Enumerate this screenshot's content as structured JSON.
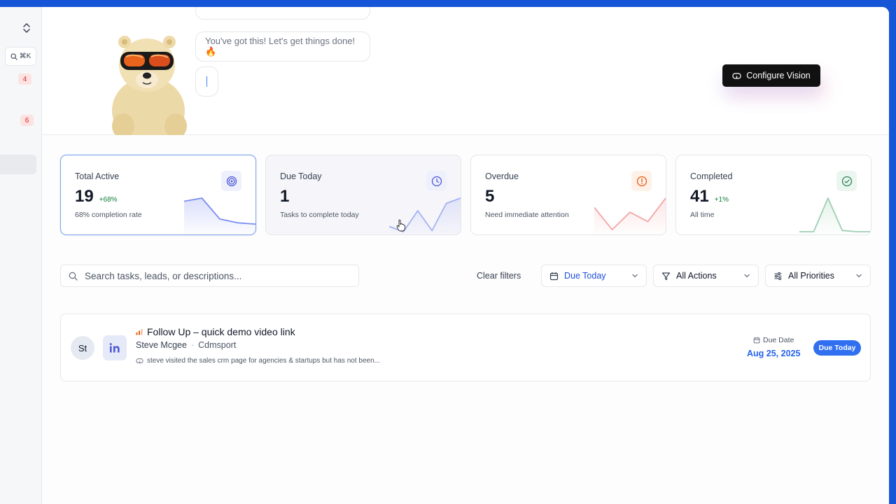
{
  "sidebar": {
    "search_shortcut": "⌘K",
    "badges": [
      "4",
      "6"
    ]
  },
  "assistant": {
    "bubble_top": "",
    "message": "You've got this! Let's get things done! 🔥",
    "configure_label": "Configure Vision"
  },
  "stats": [
    {
      "title": "Total Active",
      "value": "19",
      "delta": "+68%",
      "sub": "68% completion rate",
      "icon": "target-icon",
      "accent": "#4f5bd5",
      "icon_bg": "#eef0fc",
      "spark_color": "#7c8cf0",
      "spark": [
        48,
        53,
        20,
        14,
        12
      ]
    },
    {
      "title": "Due Today",
      "value": "1",
      "delta": "",
      "sub": "Tasks to complete today",
      "icon": "clock-icon",
      "accent": "#4f5bd5",
      "icon_bg": "#eef0fc",
      "spark_color": "#a5b1f3",
      "spark": [
        5,
        0,
        20,
        1,
        27,
        32
      ]
    },
    {
      "title": "Overdue",
      "value": "5",
      "delta": "",
      "sub": "Need immediate attention",
      "icon": "alert-circle-icon",
      "accent": "#ea580c",
      "icon_bg": "#fef1e8",
      "spark_color": "#f3a5a5",
      "spark": [
        36,
        3,
        29,
        15,
        50
      ]
    },
    {
      "title": "Completed",
      "value": "41",
      "delta": "+1%",
      "sub": "All time",
      "icon": "check-circle-icon",
      "accent": "#2f855a",
      "icon_bg": "#ecf6f0",
      "spark_color": "#9fcfb2",
      "spark": [
        0,
        0,
        52,
        2,
        0,
        0
      ]
    }
  ],
  "filters": {
    "search_placeholder": "Search tasks, leads, or descriptions...",
    "clear_label": "Clear filters",
    "due": "Due Today",
    "actions": "All Actions",
    "priorities": "All Priorities"
  },
  "task": {
    "initials": "St",
    "title": "Follow Up – quick demo video link",
    "person": "Steve Mcgee",
    "company": "Cdmsport",
    "description": "steve visited the sales crm page for agencies & startups but has not been...",
    "due_label": "Due Date",
    "due_date": "Aug 25, 2025",
    "status": "Due Today"
  }
}
